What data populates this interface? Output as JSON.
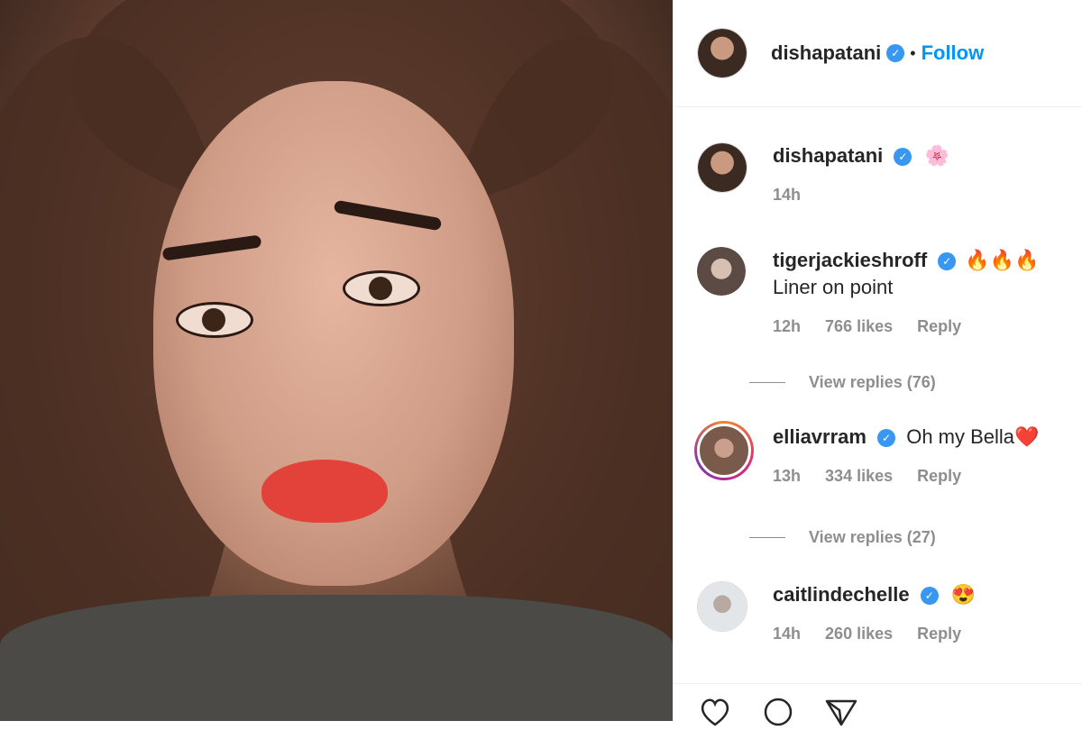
{
  "post": {
    "author": "dishapatani",
    "follow_label": "Follow",
    "separator": "•"
  },
  "caption": {
    "username": "dishapatani",
    "text": "🌸",
    "time": "14h"
  },
  "comments": [
    {
      "username": "tigerjackieshroff",
      "text": "🔥🔥🔥Liner on point",
      "time": "12h",
      "likes": "766 likes",
      "reply": "Reply",
      "view_replies": "View replies (76)"
    },
    {
      "username": "elliavrram",
      "text": "Oh my Bella❤️",
      "time": "13h",
      "likes": "334 likes",
      "reply": "Reply",
      "view_replies": "View replies (27)"
    },
    {
      "username": "caitlindechelle",
      "text": "😍",
      "time": "14h",
      "likes": "260 likes",
      "reply": "Reply"
    }
  ],
  "icons": {
    "verified": "verified-badge-icon",
    "like": "heart-icon",
    "comment": "comment-icon",
    "share": "paper-plane-icon"
  },
  "colors": {
    "follow": "#0095f6",
    "verified": "#3897f0",
    "meta": "#8e8e8e"
  }
}
